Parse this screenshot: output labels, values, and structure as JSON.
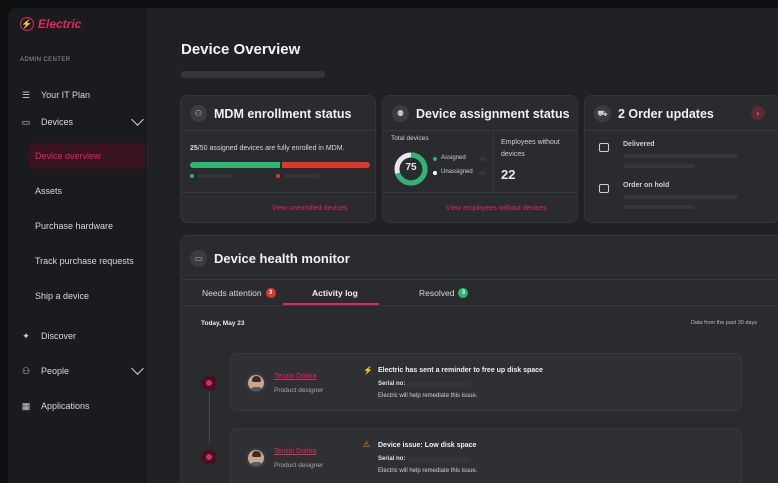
{
  "brand": {
    "name": "Electric",
    "accent": "#e8255e"
  },
  "sidebar": {
    "section_label": "ADMIN CENTER",
    "items": [
      {
        "label": "Your IT Plan",
        "icon": "checklist-icon"
      },
      {
        "label": "Devices",
        "icon": "laptop-icon"
      },
      {
        "label": "Discover",
        "icon": "sparkle-icon"
      },
      {
        "label": "People",
        "icon": "people-icon"
      },
      {
        "label": "Applications",
        "icon": "apps-grid-icon"
      }
    ],
    "devices_sub": [
      "Device overview",
      "Assets",
      "Purchase hardware",
      "Track purchase requests",
      "Ship a device"
    ]
  },
  "main": {
    "title": "Device Overview",
    "mdm": {
      "title": "MDM enrollment status",
      "enrolled": "25",
      "summary": "/50 assigned devices are fully enrolled in MDM.",
      "link": "View unenrolled devices",
      "enrolled_fraction": 0.5
    },
    "assignment": {
      "title": "Device assignment status",
      "total_label": "Total devices",
      "total": "75",
      "legend_assigned": "Assigned",
      "legend_unassigned": "Unassigned",
      "without_label": "Employees without devices",
      "without_count": "22",
      "link": "View employees without devices",
      "assigned_fraction": 0.7
    },
    "orders": {
      "title": "2 Order updates",
      "items": [
        "Delivered",
        "Order on hold"
      ]
    },
    "health": {
      "title": "Device health monitor",
      "tabs": [
        {
          "label": "Needs attention",
          "count": "3"
        },
        {
          "label": "Activity log"
        },
        {
          "label": "Resolved",
          "count": "3"
        }
      ],
      "date_label": "Today, May 23",
      "range_label": "Data from the past 30 days",
      "activities": [
        {
          "name": "Tenzin Dolma",
          "role": "Product designer",
          "title": "Electric has sent a reminder to free up disk space",
          "serial_label": "Serial no:",
          "note": "Electric will help remediate this issue."
        },
        {
          "name": "Tenzin Dolma",
          "role": "Product designer",
          "title": "Device issue: Low disk space",
          "serial_label": "Serial no:",
          "note": "Electric will help remediate this issue."
        }
      ]
    }
  },
  "colors": {
    "green": "#2bb673",
    "red": "#e0352b",
    "orange": "#f59e0b"
  }
}
